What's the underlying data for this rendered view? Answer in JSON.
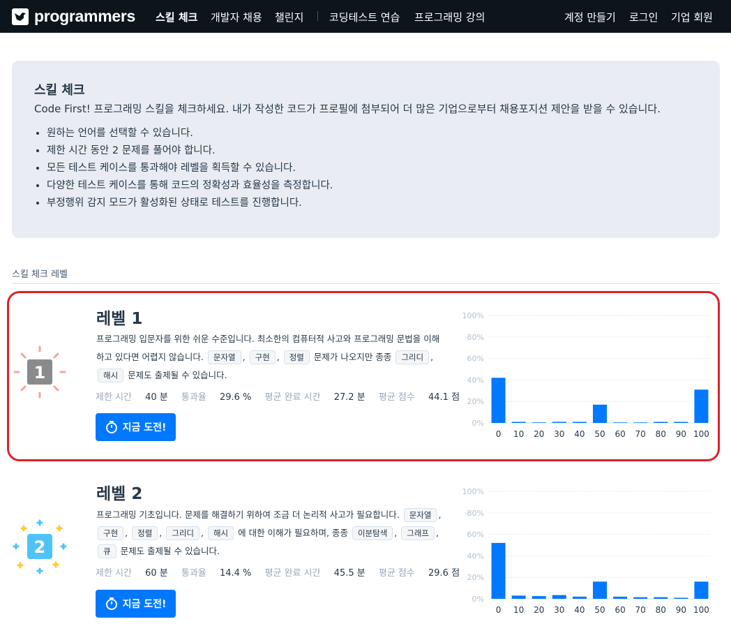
{
  "nav": {
    "logo_text": "programmers",
    "items": [
      "스킬 체크",
      "개발자 채용",
      "챌린지",
      "코딩테스트 연습",
      "프로그래밍 강의"
    ],
    "right_items": [
      "계정 만들기",
      "로그인",
      "기업 회원"
    ]
  },
  "intro": {
    "title": "스킬 체크",
    "description": "Code First! 프로그래밍 스킬을 체크하세요. 내가 작성한 코드가 프로필에 첨부되어 더 많은 기업으로부터 채용포지션 제안을 받을 수 있습니다.",
    "bullets": [
      "원하는 언어를 선택할 수 있습니다.",
      "제한 시간 동안 2 문제를 풀어야 합니다.",
      "모든 테스트 케이스를 통과해야 레벨을 획득할 수 있습니다.",
      "다양한 테스트 케이스를 통해 코드의 정확성과 효율성을 측정합니다.",
      "부정행위 감지 모드가 활성화된 상태로 테스트를 진행합니다."
    ]
  },
  "section_label": "스킬 체크 레벨",
  "levels": [
    {
      "title": "레벨 1",
      "badge": "1",
      "desc_prefix": "프로그래밍 입문자를 위한 쉬운 수준입니다. 최소한의 컴퓨터적 사고와 프로그래밍 문법을 이해하고 있다면 어렵지 않습니다.",
      "chips_a": [
        "문자열",
        "구현",
        "정렬"
      ],
      "desc_mid": "문제가 나오지만 종종",
      "chips_b": [
        "그리디",
        "해시"
      ],
      "desc_suffix": "문제도 출제될 수 있습니다.",
      "stats": {
        "time_label": "제한 시간",
        "time_value": "40 분",
        "pass_label": "통과율",
        "pass_value": "29.6 %",
        "avg_time_label": "평균 완료 시간",
        "avg_time_value": "27.2 분",
        "avg_score_label": "평균 점수",
        "avg_score_value": "44.1 점"
      },
      "button_label": "지금 도전!"
    },
    {
      "title": "레벨 2",
      "badge": "2",
      "desc_prefix": "프로그래밍 기초입니다. 문제를 해결하기 위하여 조금 더 논리적 사고가 필요합니다.",
      "chips_a": [
        "문자열",
        "구현",
        "정렬",
        "그리디",
        "해시"
      ],
      "desc_mid": "에 대한 이해가 필요하며, 종종",
      "chips_b": [
        "이분탐색",
        "그래프",
        "큐"
      ],
      "desc_suffix": "문제도 출제될 수 있습니다.",
      "stats": {
        "time_label": "제한 시간",
        "time_value": "60 분",
        "pass_label": "통과율",
        "pass_value": "14.4 %",
        "avg_time_label": "평균 완료 시간",
        "avg_time_value": "45.5 분",
        "avg_score_label": "평균 점수",
        "avg_score_value": "29.6 점"
      },
      "button_label": "지금 도전!"
    }
  ],
  "colors": {
    "bar": "#0078ff",
    "button": "#0078ff",
    "highlight": "#e0202a",
    "level1_badge": "#8a8a8a",
    "level2_badge": "#4fc3f7"
  },
  "chart_data": [
    {
      "type": "bar",
      "categories": [
        "0",
        "10",
        "20",
        "30",
        "40",
        "50",
        "60",
        "70",
        "80",
        "90",
        "100"
      ],
      "values": [
        42,
        1,
        0.5,
        1,
        1,
        17,
        0.5,
        0.5,
        1,
        1,
        31
      ],
      "yticks": [
        "0%",
        "20%",
        "40%",
        "60%",
        "80%",
        "100%"
      ],
      "ylim": [
        0,
        100
      ]
    },
    {
      "type": "bar",
      "categories": [
        "0",
        "10",
        "20",
        "30",
        "40",
        "50",
        "60",
        "70",
        "80",
        "90",
        "100"
      ],
      "values": [
        52,
        3,
        2.5,
        3.5,
        2,
        16,
        2,
        1.5,
        1.5,
        1,
        16
      ],
      "yticks": [
        "0%",
        "20%",
        "40%",
        "60%",
        "80%",
        "100%"
      ],
      "ylim": [
        0,
        100
      ]
    }
  ]
}
